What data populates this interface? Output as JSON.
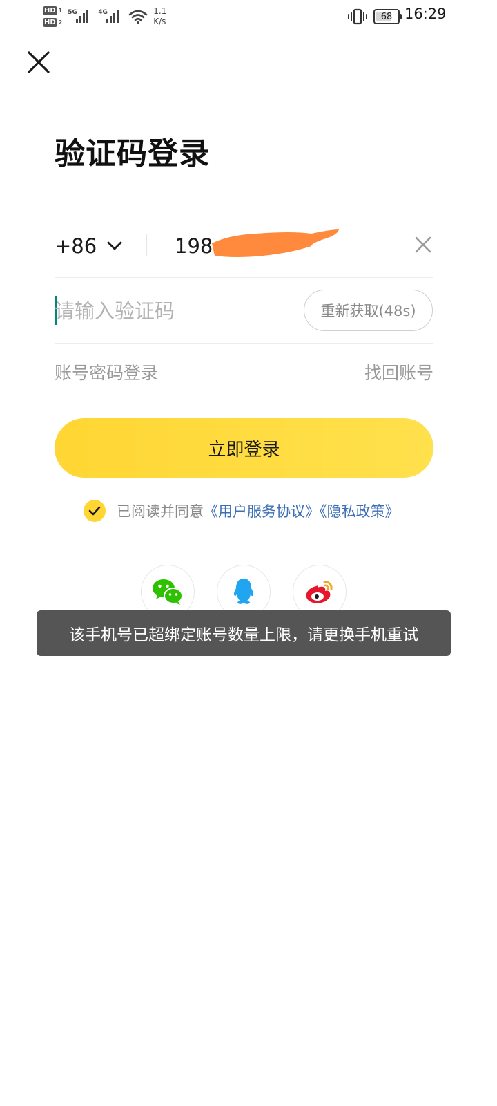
{
  "status_bar": {
    "hd1": "HD",
    "hd1_sub": "1",
    "hd2": "HD",
    "hd2_sub": "2",
    "net1": "5G",
    "net2": "4G",
    "speed_value": "1.1",
    "speed_unit": "K/s",
    "battery": "68",
    "battery_level_percent": 68,
    "time": "16:29"
  },
  "page": {
    "title": "验证码登录"
  },
  "phone": {
    "country_code": "+86",
    "value": "198"
  },
  "code": {
    "placeholder": "请输入验证码",
    "resend_label": "重新获取(48s)"
  },
  "links": {
    "password_login": "账号密码登录",
    "recover_account": "找回账号"
  },
  "login_button": "立即登录",
  "agreement": {
    "prefix": "已阅读并同意",
    "user_agreement": "《用户服务协议》",
    "privacy_policy": "《隐私政策》"
  },
  "social": [
    "wechat-icon",
    "qq-icon",
    "weibo-icon"
  ],
  "toast": "该手机号已超绑定账号数量上限，请更换手机重试",
  "colors": {
    "accent_yellow": "#FFD633",
    "link_blue": "#3D6FB5",
    "caret_teal": "#00897B",
    "toast_bg": "#555555",
    "redaction_orange": "#FF8A3D"
  }
}
